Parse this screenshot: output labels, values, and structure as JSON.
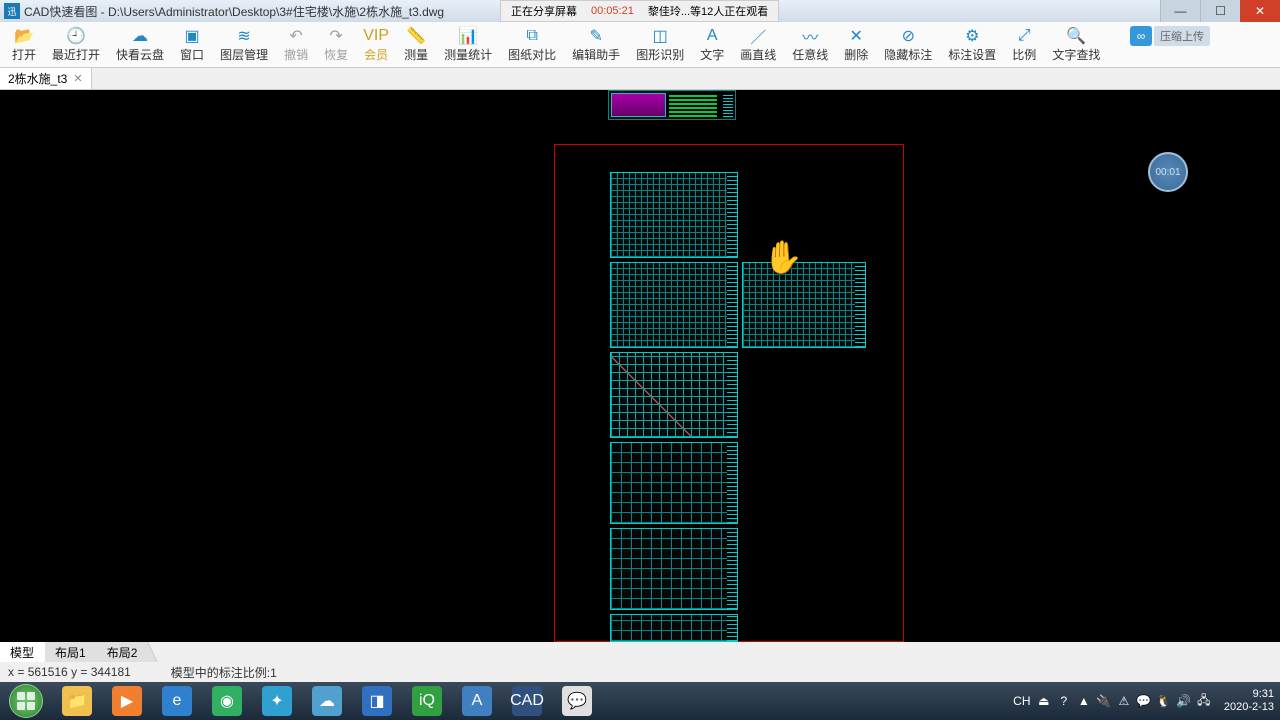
{
  "titlebar": {
    "app_glyph": "迅",
    "title": "CAD快速看图 - D:\\Users\\Administrator\\Desktop\\3#住宅楼\\水施\\2栋水施_t3.dwg"
  },
  "share_banner": {
    "status": "正在分享屏幕",
    "elapsed": "00:05:21",
    "viewers": "黎佳玲...等12人正在观看"
  },
  "toolbar": [
    {
      "key": "open",
      "label": "打开",
      "glyph": "📂",
      "color": "#2088c8"
    },
    {
      "key": "recent",
      "label": "最近打开",
      "glyph": "🕘",
      "color": "#2088c8"
    },
    {
      "key": "cloud",
      "label": "快看云盘",
      "glyph": "☁",
      "color": "#2088c8"
    },
    {
      "key": "window",
      "label": "窗口",
      "glyph": "▣",
      "color": "#2088c8"
    },
    {
      "key": "layers",
      "label": "图层管理",
      "glyph": "≋",
      "color": "#2088c8"
    },
    {
      "key": "undo",
      "label": "撤销",
      "glyph": "↶",
      "color": "#a0a0a0",
      "dis": true
    },
    {
      "key": "redo",
      "label": "恢复",
      "glyph": "↷",
      "color": "#a0a0a0",
      "dis": true
    },
    {
      "key": "vip",
      "label": "会员",
      "glyph": "VIP",
      "color": "#d0a020",
      "vip": true
    },
    {
      "key": "measure",
      "label": "测量",
      "glyph": "📏",
      "color": "#2088c8"
    },
    {
      "key": "mstats",
      "label": "测量统计",
      "glyph": "📊",
      "color": "#2088c8"
    },
    {
      "key": "compare",
      "label": "图纸对比",
      "glyph": "⧉",
      "color": "#2088c8"
    },
    {
      "key": "edithelp",
      "label": "编辑助手",
      "glyph": "✎",
      "color": "#2088c8"
    },
    {
      "key": "recognize",
      "label": "图形识别",
      "glyph": "◫",
      "color": "#2088c8"
    },
    {
      "key": "text",
      "label": "文字",
      "glyph": "A",
      "color": "#2088c8"
    },
    {
      "key": "line",
      "label": "画直线",
      "glyph": "／",
      "color": "#2088c8"
    },
    {
      "key": "freeline",
      "label": "任意线",
      "glyph": "〰",
      "color": "#2088c8"
    },
    {
      "key": "delete",
      "label": "删除",
      "glyph": "✕",
      "color": "#2088c8"
    },
    {
      "key": "hidemark",
      "label": "隐藏标注",
      "glyph": "⊘",
      "color": "#2088c8"
    },
    {
      "key": "marksettings",
      "label": "标注设置",
      "glyph": "⚙",
      "color": "#2088c8"
    },
    {
      "key": "scale",
      "label": "比例",
      "glyph": "⤢",
      "color": "#2088c8"
    },
    {
      "key": "findtext",
      "label": "文字查找",
      "glyph": "🔍",
      "color": "#2088c8"
    }
  ],
  "cloud_badge": {
    "icon": "∞",
    "text": "压缩上传"
  },
  "doc_tab": {
    "name": "2栋水施_t3",
    "close": "✕"
  },
  "timer_badge": "00:01",
  "layout_tabs": [
    "模型",
    "布局1",
    "布局2"
  ],
  "status": {
    "coords_label_x": "x = ",
    "coords_x": "561516",
    "coords_label_y": " y = ",
    "coords_y": "344181",
    "scale": "模型中的标注比例:1"
  },
  "taskbar_apps": [
    {
      "key": "explorer",
      "bg": "#f0c050",
      "glyph": "📁"
    },
    {
      "key": "media",
      "bg": "#f08030",
      "glyph": "▶"
    },
    {
      "key": "ie",
      "bg": "#3080d0",
      "glyph": "e"
    },
    {
      "key": "chrome360",
      "bg": "#30b060",
      "glyph": "◉"
    },
    {
      "key": "tool1",
      "bg": "#30a0d0",
      "glyph": "✦"
    },
    {
      "key": "cloud",
      "bg": "#50a0d0",
      "glyph": "☁"
    },
    {
      "key": "app1",
      "bg": "#3070c0",
      "glyph": "◨"
    },
    {
      "key": "iqiyi",
      "bg": "#30a040",
      "glyph": "iQ"
    },
    {
      "key": "appA",
      "bg": "#4080c0",
      "glyph": "A"
    },
    {
      "key": "cad",
      "bg": "#305080",
      "glyph": "CAD"
    },
    {
      "key": "chat",
      "bg": "#e0e0e0",
      "glyph": "💬"
    }
  ],
  "tray": {
    "ime": "CH",
    "items": [
      "⏏",
      "?",
      "▲",
      "🔌",
      "⚠",
      "💬",
      "🐧",
      "🔊",
      "🖧"
    ],
    "time": "9:31",
    "date": "2020-2-13"
  }
}
